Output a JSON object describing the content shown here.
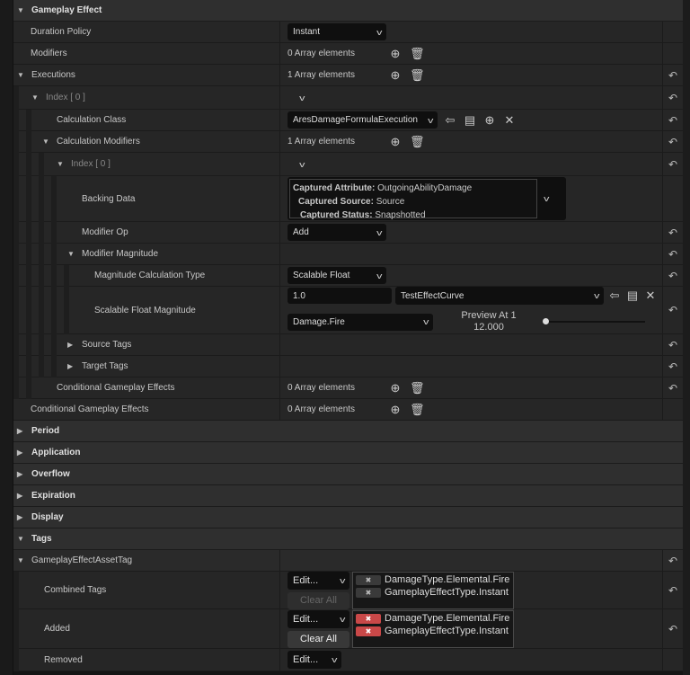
{
  "categories": {
    "gameplay_effect": "Gameplay Effect",
    "period": "Period",
    "application": "Application",
    "overflow": "Overflow",
    "expiration": "Expiration",
    "display": "Display",
    "tags": "Tags"
  },
  "rows": {
    "duration_policy": {
      "label": "Duration Policy",
      "value": "Instant"
    },
    "modifiers": {
      "label": "Modifiers",
      "value": "0 Array elements"
    },
    "executions": {
      "label": "Executions",
      "value": "1 Array elements"
    },
    "exec_index": {
      "label": "Index [ 0 ]"
    },
    "calc_class": {
      "label": "Calculation Class",
      "value": "AresDamageFormulaExecution"
    },
    "calc_mods": {
      "label": "Calculation Modifiers",
      "value": "1 Array elements"
    },
    "mod_index": {
      "label": "Index [ 0 ]"
    },
    "backing_data": {
      "label": "Backing Data",
      "attr_k": "Captured Attribute:",
      "attr_v": "OutgoingAbilityDamage",
      "src_k": "Captured Source:",
      "src_v": "Source",
      "status_k": "Captured Status:",
      "status_v": "Snapshotted"
    },
    "modifier_op": {
      "label": "Modifier Op",
      "value": "Add"
    },
    "modifier_magnitude": {
      "label": "Modifier Magnitude"
    },
    "mag_calc_type": {
      "label": "Magnitude Calculation Type",
      "value": "Scalable Float"
    },
    "scalable_float": {
      "label": "Scalable Float Magnitude",
      "value": "1.0",
      "curve": "TestEffectCurve",
      "row": "Damage.Fire",
      "preview_label": "Preview At 1",
      "preview_value": "12.000",
      "slider": 0
    },
    "source_tags": {
      "label": "Source Tags"
    },
    "target_tags": {
      "label": "Target Tags"
    },
    "cond_inner": {
      "label": "Conditional Gameplay Effects",
      "value": "0 Array elements"
    },
    "cond_outer": {
      "label": "Conditional Gameplay Effects",
      "value": "0 Array elements"
    },
    "asset_tag": {
      "label": "GameplayEffectAssetTag"
    },
    "combined": {
      "label": "Combined Tags",
      "edit": "Edit...",
      "clear": "Clear All",
      "tags": [
        "DamageType.Elemental.Fire",
        "GameplayEffectType.Instant"
      ]
    },
    "added": {
      "label": "Added",
      "edit": "Edit...",
      "clear": "Clear All",
      "tags": [
        "DamageType.Elemental.Fire",
        "GameplayEffectType.Instant"
      ]
    },
    "removed": {
      "label": "Removed",
      "edit": "Edit..."
    }
  },
  "colors": {
    "accent_red": "#c94848"
  }
}
